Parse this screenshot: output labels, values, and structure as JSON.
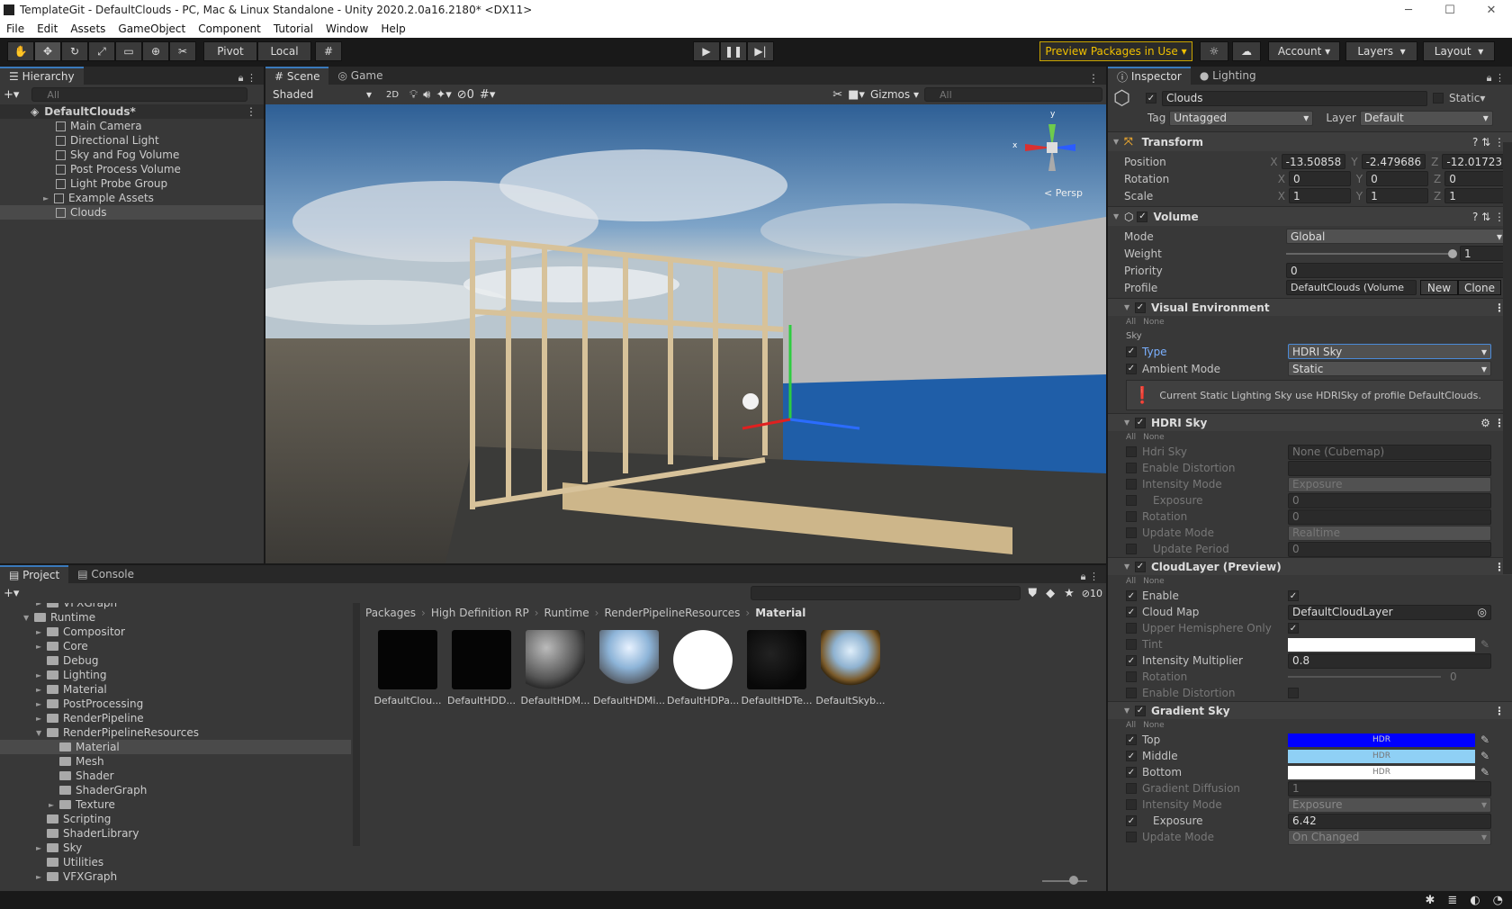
{
  "window": {
    "title": "TemplateGit - DefaultClouds - PC, Mac & Linux Standalone - Unity 2020.2.0a16.2180* <DX11>"
  },
  "menu": [
    "File",
    "Edit",
    "Assets",
    "GameObject",
    "Component",
    "Tutorial",
    "Window",
    "Help"
  ],
  "toolbar": {
    "pivot": "Pivot",
    "local": "Local",
    "preview_packages": "Preview Packages in Use",
    "account": "Account",
    "layers": "Layers",
    "layout": "Layout"
  },
  "hierarchy": {
    "tab": "Hierarchy",
    "search_placeholder": "All",
    "scene": "DefaultClouds*",
    "items": [
      "Main Camera",
      "Directional Light",
      "Sky and Fog Volume",
      "Post Process Volume",
      "Light Probe Group",
      "Example Assets",
      "Clouds"
    ]
  },
  "scene": {
    "tab_scene": "Scene",
    "tab_game": "Game",
    "shading": "Shaded",
    "mode2d": "2D",
    "hidden_count": "0",
    "gizmos": "Gizmos",
    "search_placeholder": "All",
    "persp": "< Persp",
    "axis_x": "x",
    "axis_y": "y"
  },
  "project": {
    "tab_project": "Project",
    "tab_console": "Console",
    "hidden_count": "10",
    "breadcrumb": [
      "Packages",
      "High Definition RP",
      "Runtime",
      "RenderPipelineResources",
      "Material"
    ],
    "tree": [
      {
        "label": "VFXGraph",
        "indent": 2,
        "arrow": "►"
      },
      {
        "label": "Runtime",
        "indent": 1,
        "arrow": "▼"
      },
      {
        "label": "Compositor",
        "indent": 2,
        "arrow": "►"
      },
      {
        "label": "Core",
        "indent": 2,
        "arrow": "►"
      },
      {
        "label": "Debug",
        "indent": 2,
        "arrow": ""
      },
      {
        "label": "Lighting",
        "indent": 2,
        "arrow": "►"
      },
      {
        "label": "Material",
        "indent": 2,
        "arrow": "►"
      },
      {
        "label": "PostProcessing",
        "indent": 2,
        "arrow": "►"
      },
      {
        "label": "RenderPipeline",
        "indent": 2,
        "arrow": "►"
      },
      {
        "label": "RenderPipelineResources",
        "indent": 2,
        "arrow": "▼"
      },
      {
        "label": "Material",
        "indent": 3,
        "arrow": "",
        "selected": true
      },
      {
        "label": "Mesh",
        "indent": 3,
        "arrow": ""
      },
      {
        "label": "Shader",
        "indent": 3,
        "arrow": ""
      },
      {
        "label": "ShaderGraph",
        "indent": 3,
        "arrow": ""
      },
      {
        "label": "Texture",
        "indent": 3,
        "arrow": "►"
      },
      {
        "label": "Scripting",
        "indent": 2,
        "arrow": ""
      },
      {
        "label": "ShaderLibrary",
        "indent": 2,
        "arrow": ""
      },
      {
        "label": "Sky",
        "indent": 2,
        "arrow": "►"
      },
      {
        "label": "Utilities",
        "indent": 2,
        "arrow": ""
      },
      {
        "label": "VFXGraph",
        "indent": 2,
        "arrow": "►"
      }
    ],
    "assets": [
      {
        "label": "DefaultClou...",
        "kind": "black"
      },
      {
        "label": "DefaultHDD...",
        "kind": "black"
      },
      {
        "label": "DefaultHDM...",
        "kind": "grey"
      },
      {
        "label": "DefaultHDMi...",
        "kind": "sky"
      },
      {
        "label": "DefaultHDPa...",
        "kind": "white"
      },
      {
        "label": "DefaultHDTe...",
        "kind": "dark"
      },
      {
        "label": "DefaultSkyb...",
        "kind": "skybox"
      }
    ]
  },
  "inspector": {
    "tab_inspector": "Inspector",
    "tab_lighting": "Lighting",
    "object_name": "Clouds",
    "static": "Static",
    "tag_label": "Tag",
    "tag_value": "Untagged",
    "layer_label": "Layer",
    "layer_value": "Default",
    "transform": {
      "title": "Transform",
      "position": "Position",
      "rotation": "Rotation",
      "scale": "Scale",
      "pos": [
        "-13.50858",
        "-2.479686",
        "-12.01723"
      ],
      "rot": [
        "0",
        "0",
        "0"
      ],
      "scl": [
        "1",
        "1",
        "1"
      ]
    },
    "volume": {
      "title": "Volume",
      "mode_label": "Mode",
      "mode": "Global",
      "weight_label": "Weight",
      "weight": "1",
      "weight_fraction": 1,
      "priority_label": "Priority",
      "priority": "0",
      "profile_label": "Profile",
      "profile": "DefaultClouds (Volume",
      "new": "New",
      "clone": "Clone"
    },
    "visual_env": {
      "title": "Visual Environment",
      "all": "All",
      "none": "None",
      "sky": "Sky",
      "type_label": "Type",
      "type": "HDRI Sky",
      "ambient_label": "Ambient Mode",
      "ambient": "Static",
      "help": "Current Static Lighting Sky use HDRISky of profile DefaultClouds."
    },
    "hdri": {
      "title": "HDRI Sky",
      "all": "All",
      "none": "None",
      "rows": [
        {
          "label": "Hdri Sky",
          "value": "None (Cubemap)"
        },
        {
          "label": "Enable Distortion",
          "value": ""
        },
        {
          "label": "Intensity Mode",
          "value": "Exposure"
        },
        {
          "label": "Exposure",
          "value": "0"
        },
        {
          "label": "Rotation",
          "value": "0"
        },
        {
          "label": "Update Mode",
          "value": "Realtime"
        },
        {
          "label": "Update Period",
          "value": "0"
        }
      ]
    },
    "cloud": {
      "title": "CloudLayer (Preview)",
      "all": "All",
      "none": "None",
      "enable": "Enable",
      "cloud_map": "Cloud Map",
      "cloud_map_value": "DefaultCloudLayer",
      "upper": "Upper Hemisphere Only",
      "tint": "Tint",
      "intensity": "Intensity Multiplier",
      "intensity_value": "0.8",
      "rotation": "Rotation",
      "rotation_value": "0",
      "distortion": "Enable Distortion"
    },
    "gradient": {
      "title": "Gradient Sky",
      "all": "All",
      "none": "None",
      "top": "Top",
      "middle": "Middle",
      "bottom": "Bottom",
      "hdr": "HDR",
      "diffusion": "Gradient Diffusion",
      "diffusion_value": "1",
      "intensity_mode": "Intensity Mode",
      "intensity_mode_value": "Exposure",
      "exposure": "Exposure",
      "exposure_value": "6.42",
      "update_mode": "Update Mode",
      "update_mode_value": "On Changed",
      "colors": {
        "top": "#0000ff",
        "middle": "#8fd0f5",
        "bottom": "#ffffff"
      }
    }
  }
}
